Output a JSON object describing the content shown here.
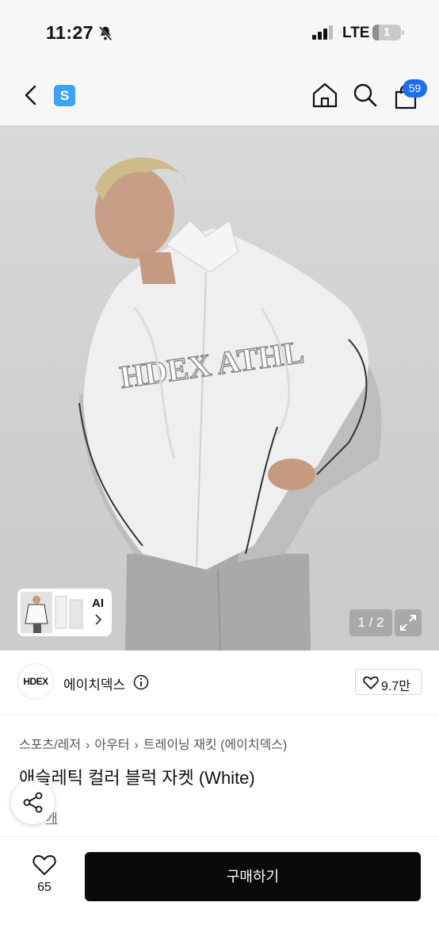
{
  "status": {
    "time": "11:27",
    "network": "LTE",
    "battery": "1"
  },
  "nav": {
    "app_logo": "S",
    "cart_count": "59"
  },
  "hero": {
    "image_desc": "model wearing white and grey track jacket",
    "thumb_label": "AI",
    "pager": "1 / 2"
  },
  "brand": {
    "logo_text": "HDEX",
    "name": "에이치덱스",
    "likes": "9.7만"
  },
  "breadcrumb": [
    "스포츠/레저",
    "아우터",
    "트레이닝 재킷 (에이치덱스)"
  ],
  "product": {
    "title": "애슬레틱 컬러 블럭 자켓 (White)",
    "sub_link": "개"
  },
  "bottom": {
    "wish_count": "65",
    "buy_label": "구매하기"
  },
  "colors": {
    "accent_blue": "#1d6df0",
    "logo_blue": "#3fa3f5",
    "buy_button": "#0a0a0a"
  }
}
